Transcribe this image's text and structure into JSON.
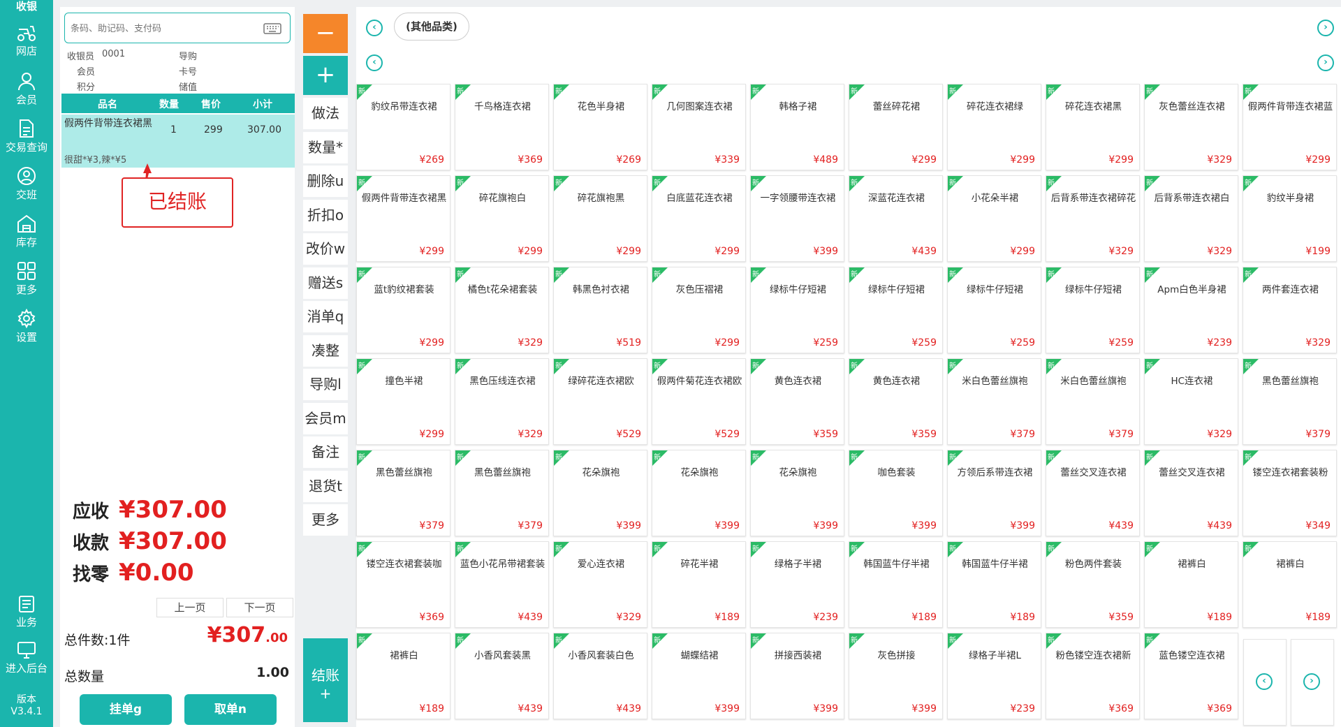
{
  "sidebar": {
    "title": "收银",
    "items": [
      {
        "label": "网店",
        "icon": "scooter-icon"
      },
      {
        "label": "会员",
        "icon": "user-icon"
      },
      {
        "label": "交易查询",
        "icon": "document-icon"
      },
      {
        "label": "交班",
        "icon": "user-switch-icon"
      },
      {
        "label": "库存",
        "icon": "warehouse-icon"
      },
      {
        "label": "更多",
        "icon": "grid-icon"
      },
      {
        "label": "设置",
        "icon": "gear-icon"
      },
      {
        "label": "业务",
        "icon": "business-icon"
      },
      {
        "label": "进入后台",
        "icon": "monitor-icon"
      }
    ],
    "version_label": "版本",
    "version": "V3.4.1"
  },
  "order": {
    "search_placeholder": "条码、助记码、支付码",
    "cashier_label": "收银员",
    "cashier_value": "0001",
    "guide_label": "导购",
    "member_label": "会员",
    "card_label": "卡号",
    "points_label": "积分",
    "stored_label": "储值",
    "columns": [
      "品名",
      "数量",
      "售价",
      "小计"
    ],
    "row": {
      "name": "假两件背带连衣裙黑",
      "qty": "1",
      "price": "299",
      "subtotal": "307.00",
      "note": "很甜*¥3,辣*¥5"
    },
    "status_stamp": "已结账",
    "receivable_label": "应收",
    "receivable": "¥307.00",
    "paid_label": "收款",
    "paid": "¥307.00",
    "change_label": "找零",
    "change": "¥0.00",
    "prev_page": "上一页",
    "next_page": "下一页",
    "total_items_label": "总件数:1件",
    "total_amount_main": "¥307",
    "total_amount_dec": ".00",
    "total_qty_label": "总数量",
    "total_qty": "1.00",
    "hold_button": "挂单g",
    "retrieve_button": "取单n"
  },
  "actions": {
    "minus": "−",
    "plus": "+",
    "buttons": [
      "做法",
      "数量*",
      "删除u",
      "折扣o",
      "改价w",
      "赠送s",
      "消单q",
      "凑整",
      "导购l",
      "会员m",
      "备注",
      "退货t",
      "更多"
    ],
    "checkout": "结账",
    "checkout_sub": "+"
  },
  "catalog": {
    "category_tab": "(其他品类)",
    "new_badge": "新",
    "products": [
      {
        "name": "豹纹吊带连衣裙",
        "price": "¥269"
      },
      {
        "name": "千鸟格连衣裙",
        "price": "¥369"
      },
      {
        "name": "花色半身裙",
        "price": "¥269"
      },
      {
        "name": "几何图案连衣裙",
        "price": "¥339"
      },
      {
        "name": "韩格子裙",
        "price": "¥489"
      },
      {
        "name": "蕾丝碎花裙",
        "price": "¥299"
      },
      {
        "name": "碎花连衣裙绿",
        "price": "¥299"
      },
      {
        "name": "碎花连衣裙黑",
        "price": "¥299"
      },
      {
        "name": "灰色蕾丝连衣裙",
        "price": "¥329"
      },
      {
        "name": "假两件背带连衣裙蓝",
        "price": "¥299"
      },
      {
        "name": "假两件背带连衣裙黑",
        "price": "¥299"
      },
      {
        "name": "碎花旗袍白",
        "price": "¥299"
      },
      {
        "name": "碎花旗袍黑",
        "price": "¥299"
      },
      {
        "name": "白底蓝花连衣裙",
        "price": "¥299"
      },
      {
        "name": "一字领腰带连衣裙",
        "price": "¥399"
      },
      {
        "name": "深蓝花连衣裙",
        "price": "¥439"
      },
      {
        "name": "小花朵半裙",
        "price": "¥299"
      },
      {
        "name": "后背系带连衣裙碎花",
        "price": "¥329"
      },
      {
        "name": "后背系带连衣裙白",
        "price": "¥329"
      },
      {
        "name": "豹纹半身裙",
        "price": "¥199"
      },
      {
        "name": "蓝t豹纹裙套装",
        "price": "¥299"
      },
      {
        "name": "橘色t花朵裙套装",
        "price": "¥329"
      },
      {
        "name": "韩黑色衬衣裙",
        "price": "¥519"
      },
      {
        "name": "灰色压褶裙",
        "price": "¥299"
      },
      {
        "name": "绿标牛仔短裙",
        "price": "¥259"
      },
      {
        "name": "绿标牛仔短裙",
        "price": "¥259"
      },
      {
        "name": "绿标牛仔短裙",
        "price": "¥259"
      },
      {
        "name": "绿标牛仔短裙",
        "price": "¥259"
      },
      {
        "name": "Apm白色半身裙",
        "price": "¥239"
      },
      {
        "name": "两件套连衣裙",
        "price": "¥329"
      },
      {
        "name": "撞色半裙",
        "price": "¥299"
      },
      {
        "name": "黑色压线连衣裙",
        "price": "¥329"
      },
      {
        "name": "绿碎花连衣裙欧",
        "price": "¥529"
      },
      {
        "name": "假两件菊花连衣裙欧",
        "price": "¥529"
      },
      {
        "name": "黄色连衣裙",
        "price": "¥359"
      },
      {
        "name": "黄色连衣裙",
        "price": "¥359"
      },
      {
        "name": "米白色蕾丝旗袍",
        "price": "¥379"
      },
      {
        "name": "米白色蕾丝旗袍",
        "price": "¥379"
      },
      {
        "name": "HC连衣裙",
        "price": "¥329"
      },
      {
        "name": "黑色蕾丝旗袍",
        "price": "¥379"
      },
      {
        "name": "黑色蕾丝旗袍",
        "price": "¥379"
      },
      {
        "name": "黑色蕾丝旗袍",
        "price": "¥379"
      },
      {
        "name": "花朵旗袍",
        "price": "¥399"
      },
      {
        "name": "花朵旗袍",
        "price": "¥399"
      },
      {
        "name": "花朵旗袍",
        "price": "¥399"
      },
      {
        "name": "咖色套装",
        "price": "¥399"
      },
      {
        "name": "方领后系带连衣裙",
        "price": "¥399"
      },
      {
        "name": "蕾丝交叉连衣裙",
        "price": "¥439"
      },
      {
        "name": "蕾丝交叉连衣裙",
        "price": "¥439"
      },
      {
        "name": "镂空连衣裙套装粉",
        "price": "¥349"
      },
      {
        "name": "镂空连衣裙套装咖",
        "price": "¥369"
      },
      {
        "name": "蓝色小花吊带裙套装",
        "price": "¥439"
      },
      {
        "name": "爱心连衣裙",
        "price": "¥329"
      },
      {
        "name": "碎花半裙",
        "price": "¥189"
      },
      {
        "name": "绿格子半裙",
        "price": "¥239"
      },
      {
        "name": "韩国蓝牛仔半裙",
        "price": "¥189"
      },
      {
        "name": "韩国蓝牛仔半裙",
        "price": "¥189"
      },
      {
        "name": "粉色两件套装",
        "price": "¥359"
      },
      {
        "name": "裙裤白",
        "price": "¥189"
      },
      {
        "name": "裙裤白",
        "price": "¥189"
      },
      {
        "name": "裙裤白",
        "price": "¥189"
      },
      {
        "name": "小香风套装黑",
        "price": "¥439"
      },
      {
        "name": "小香风套装白色",
        "price": "¥439"
      },
      {
        "name": "蝴蝶结裙",
        "price": "¥399"
      },
      {
        "name": "拼接西装裙",
        "price": "¥399"
      },
      {
        "name": "灰色拼接",
        "price": "¥399"
      },
      {
        "name": "绿格子半裙L",
        "price": "¥239"
      },
      {
        "name": "粉色镂空连衣裙新",
        "price": "¥369"
      },
      {
        "name": "蓝色镂空连衣裙",
        "price": "¥369"
      }
    ]
  },
  "colors": {
    "primary": "#1bb5ad",
    "accent": "#f5862a",
    "price": "#e22020",
    "new_badge": "#2bbb66"
  }
}
